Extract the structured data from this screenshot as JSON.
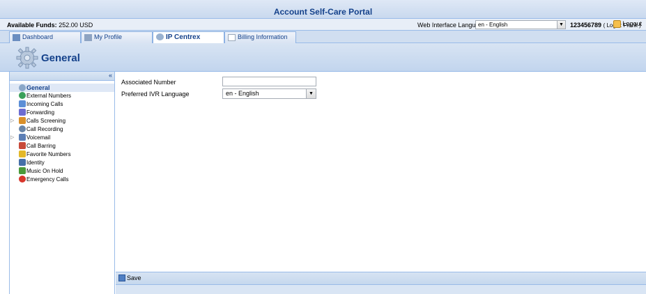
{
  "app": {
    "title": "Account Self-Care Portal"
  },
  "info": {
    "funds_label": "Available Funds:",
    "funds_value": "252.00 USD",
    "language_label": "Web Interface Language:",
    "language_value": "en - English",
    "account_number": "123456789",
    "login_text": "( Login: Frank )",
    "logout_label": "Logout"
  },
  "tabs": [
    {
      "label": "Dashboard",
      "icon": "dashboard-icon"
    },
    {
      "label": "My Profile",
      "icon": "profile-icon"
    },
    {
      "label": "IP Centrex",
      "icon": "gear-icon",
      "active": true
    },
    {
      "label": "Billing Information",
      "icon": "document-icon"
    }
  ],
  "page": {
    "title": "General"
  },
  "sidebar": {
    "collapse_label": "«",
    "items": [
      {
        "label": "General",
        "selected": true,
        "icon": "gear-icon",
        "color": "#8aa7c8"
      },
      {
        "label": "External Numbers",
        "icon": "globe-icon",
        "color": "#3aa05a"
      },
      {
        "label": "Incoming Calls",
        "icon": "phone-in-icon",
        "color": "#5b8ed6"
      },
      {
        "label": "Forwarding",
        "icon": "forward-icon",
        "color": "#6c6cd1"
      },
      {
        "label": "Calls Screening",
        "expandable": true,
        "icon": "screening-icon",
        "color": "#d9902a"
      },
      {
        "label": "Call Recording",
        "icon": "recording-icon",
        "color": "#6a86a8"
      },
      {
        "label": "Voicemail",
        "expandable": true,
        "icon": "voicemail-icon",
        "color": "#5d7fb5"
      },
      {
        "label": "Call Barring",
        "icon": "barring-icon",
        "color": "#c84a3a"
      },
      {
        "label": "Favorite Numbers",
        "icon": "star-icon",
        "color": "#e3b829"
      },
      {
        "label": "Identity",
        "icon": "identity-icon",
        "color": "#456fa8"
      },
      {
        "label": "Music On Hold",
        "icon": "music-icon",
        "color": "#4b9a3a"
      },
      {
        "label": "Emergency Calls",
        "icon": "emergency-icon",
        "color": "#d8372c"
      }
    ]
  },
  "form": {
    "associated_number_label": "Associated Number",
    "associated_number_value": "",
    "ivr_language_label": "Preferred IVR Language",
    "ivr_language_value": "en - English"
  },
  "toolbar": {
    "save_label": "Save"
  }
}
